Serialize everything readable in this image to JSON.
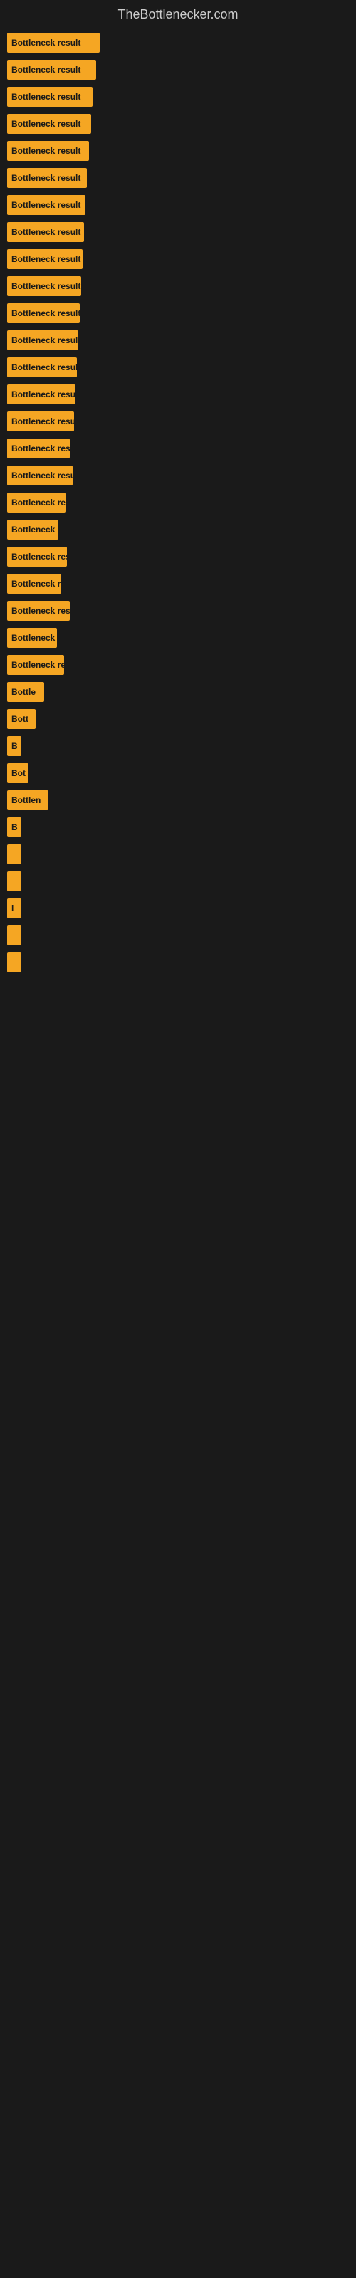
{
  "site": {
    "title": "TheBottlenecker.com"
  },
  "bars": [
    {
      "label": "Bottleneck result",
      "width": 130
    },
    {
      "label": "Bottleneck result",
      "width": 125
    },
    {
      "label": "Bottleneck result",
      "width": 120
    },
    {
      "label": "Bottleneck result",
      "width": 118
    },
    {
      "label": "Bottleneck result",
      "width": 115
    },
    {
      "label": "Bottleneck result",
      "width": 112
    },
    {
      "label": "Bottleneck result",
      "width": 110
    },
    {
      "label": "Bottleneck result",
      "width": 108
    },
    {
      "label": "Bottleneck result",
      "width": 106
    },
    {
      "label": "Bottleneck result",
      "width": 104
    },
    {
      "label": "Bottleneck result",
      "width": 102
    },
    {
      "label": "Bottleneck result",
      "width": 100
    },
    {
      "label": "Bottleneck result",
      "width": 98
    },
    {
      "label": "Bottleneck result",
      "width": 96
    },
    {
      "label": "Bottleneck result",
      "width": 94
    },
    {
      "label": "Bottleneck resu",
      "width": 88
    },
    {
      "label": "Bottleneck result",
      "width": 92
    },
    {
      "label": "Bottleneck re",
      "width": 82
    },
    {
      "label": "Bottleneck",
      "width": 72
    },
    {
      "label": "Bottleneck res",
      "width": 84
    },
    {
      "label": "Bottleneck r",
      "width": 76
    },
    {
      "label": "Bottleneck resu",
      "width": 88
    },
    {
      "label": "Bottleneck",
      "width": 70
    },
    {
      "label": "Bottleneck re",
      "width": 80
    },
    {
      "label": "Bottle",
      "width": 52
    },
    {
      "label": "Bott",
      "width": 40
    },
    {
      "label": "B",
      "width": 18
    },
    {
      "label": "Bot",
      "width": 30
    },
    {
      "label": "Bottlen",
      "width": 58
    },
    {
      "label": "B",
      "width": 16
    },
    {
      "label": "",
      "width": 10
    },
    {
      "label": "",
      "width": 8
    },
    {
      "label": "l",
      "width": 6
    },
    {
      "label": "",
      "width": 5
    },
    {
      "label": "",
      "width": 4
    }
  ]
}
